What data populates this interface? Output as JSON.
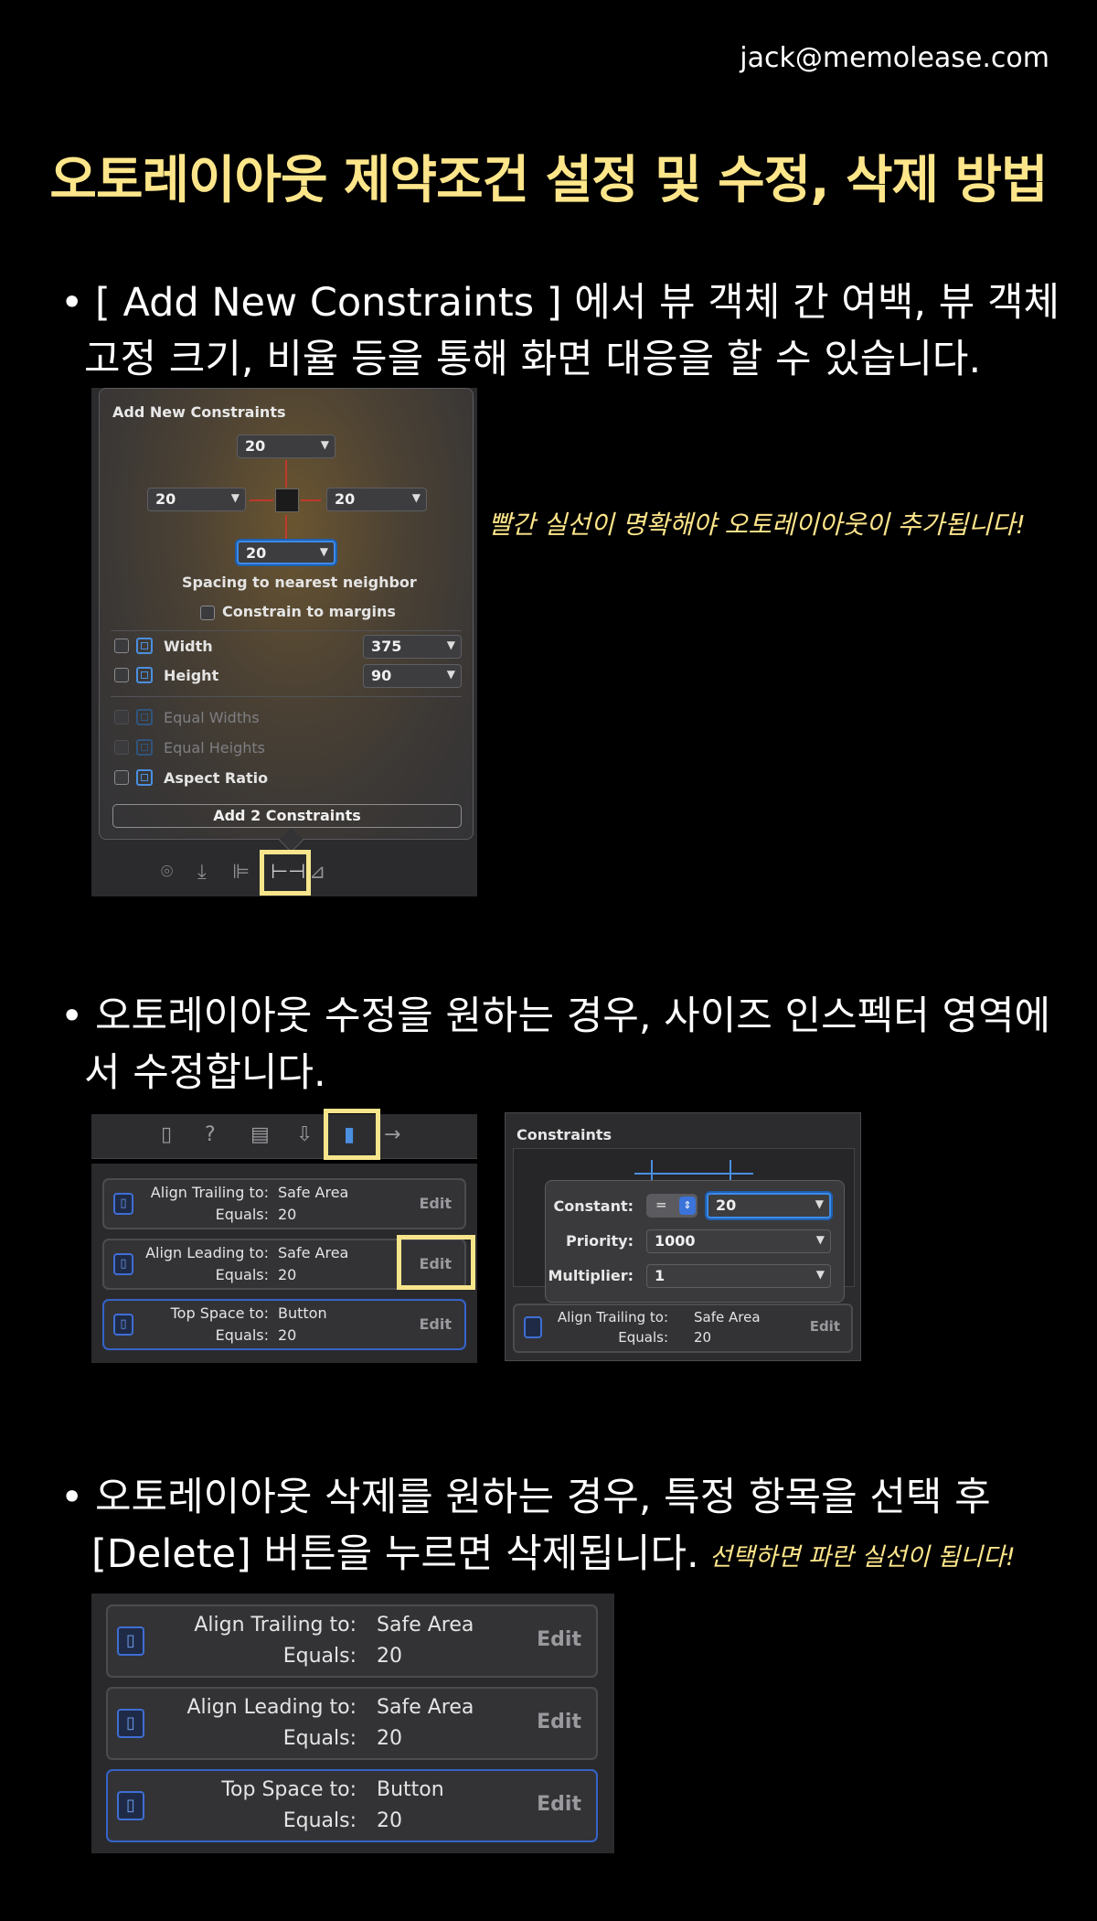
{
  "header": {
    "email": "jack@memolease.com",
    "title": "오토레이아웃 제약조건 설정 및 수정, 삭제 방법"
  },
  "section1": {
    "bullet": "•",
    "line1": "[ Add New Constraints ] 에서 뷰 객체 간 여백, 뷰 객체",
    "line2": "고정 크기, 비율 등을 통해 화면 대응을 할 수 있습니다.",
    "note": "빨간 실선이 명확해야 오토레이아웃이 추가됩니다!"
  },
  "add_constraints_panel": {
    "title": "Add New Constraints",
    "top": "20",
    "left": "20",
    "right": "20",
    "bottom": "20",
    "spacing_label": "Spacing to nearest neighbor",
    "margins_label": "Constrain to margins",
    "width_label": "Width",
    "width_value": "375",
    "height_label": "Height",
    "height_value": "90",
    "equal_widths": "Equal Widths",
    "equal_heights": "Equal Heights",
    "aspect_ratio": "Aspect Ratio",
    "add_button": "Add 2 Constraints"
  },
  "section2": {
    "bullet": "•",
    "line1": "오토레이아웃 수정을 원하는 경우, 사이즈 인스펙터 영역에",
    "line2": "서 수정합니다."
  },
  "constraint_list": {
    "items": [
      {
        "key1": "Align Trailing to:",
        "val1": "Safe Area",
        "key2": "Equals:",
        "val2": "20",
        "edit": "Edit"
      },
      {
        "key1": "Align Leading to:",
        "val1": "Safe Area",
        "key2": "Equals:",
        "val2": "20",
        "edit": "Edit"
      },
      {
        "key1": "Top Space to:",
        "val1": "Button",
        "key2": "Equals:",
        "val2": "20",
        "edit": "Edit"
      }
    ]
  },
  "constant_popover": {
    "header": "Constraints",
    "constant_label": "Constant:",
    "relation": "=",
    "constant_value": "20",
    "priority_label": "Priority:",
    "priority_value": "1000",
    "multiplier_label": "Multiplier:",
    "multiplier_value": "1",
    "row_key1": "Align Trailing to:",
    "row_val1": "Safe Area",
    "row_key2": "Equals:",
    "row_val2": "20",
    "row_edit": "Edit"
  },
  "section3": {
    "bullet": "•",
    "line1": "오토레이아웃 삭제를 원하는 경우, 특정 항목을 선택 후",
    "line2": "[Delete] 버튼을 누르면 삭제됩니다.",
    "note": "선택하면 파란 실선이 됩니다!"
  },
  "colors": {
    "accent_yellow": "#fde58a",
    "highlight_box": "#f7e58c",
    "constraint_red": "#c0392b",
    "selection_blue": "#3563c9"
  }
}
